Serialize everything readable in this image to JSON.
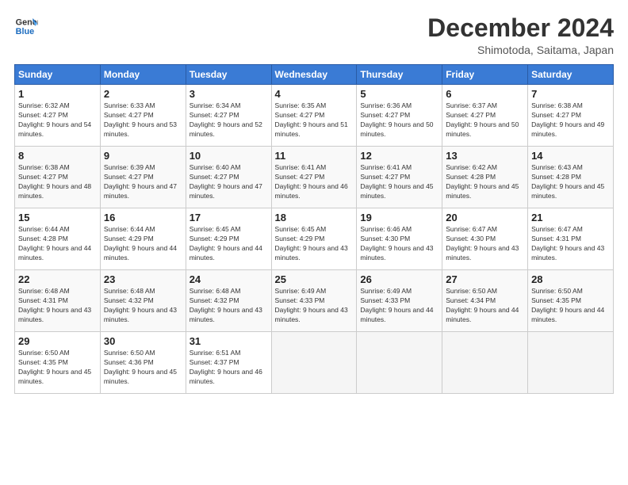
{
  "header": {
    "logo_line1": "General",
    "logo_line2": "Blue",
    "month": "December 2024",
    "location": "Shimotoda, Saitama, Japan"
  },
  "weekdays": [
    "Sunday",
    "Monday",
    "Tuesday",
    "Wednesday",
    "Thursday",
    "Friday",
    "Saturday"
  ],
  "weeks": [
    [
      {
        "num": "1",
        "sunrise": "6:32 AM",
        "sunset": "4:27 PM",
        "daylight": "9 hours and 54 minutes."
      },
      {
        "num": "2",
        "sunrise": "6:33 AM",
        "sunset": "4:27 PM",
        "daylight": "9 hours and 53 minutes."
      },
      {
        "num": "3",
        "sunrise": "6:34 AM",
        "sunset": "4:27 PM",
        "daylight": "9 hours and 52 minutes."
      },
      {
        "num": "4",
        "sunrise": "6:35 AM",
        "sunset": "4:27 PM",
        "daylight": "9 hours and 51 minutes."
      },
      {
        "num": "5",
        "sunrise": "6:36 AM",
        "sunset": "4:27 PM",
        "daylight": "9 hours and 50 minutes."
      },
      {
        "num": "6",
        "sunrise": "6:37 AM",
        "sunset": "4:27 PM",
        "daylight": "9 hours and 50 minutes."
      },
      {
        "num": "7",
        "sunrise": "6:38 AM",
        "sunset": "4:27 PM",
        "daylight": "9 hours and 49 minutes."
      }
    ],
    [
      {
        "num": "8",
        "sunrise": "6:38 AM",
        "sunset": "4:27 PM",
        "daylight": "9 hours and 48 minutes."
      },
      {
        "num": "9",
        "sunrise": "6:39 AM",
        "sunset": "4:27 PM",
        "daylight": "9 hours and 47 minutes."
      },
      {
        "num": "10",
        "sunrise": "6:40 AM",
        "sunset": "4:27 PM",
        "daylight": "9 hours and 47 minutes."
      },
      {
        "num": "11",
        "sunrise": "6:41 AM",
        "sunset": "4:27 PM",
        "daylight": "9 hours and 46 minutes."
      },
      {
        "num": "12",
        "sunrise": "6:41 AM",
        "sunset": "4:27 PM",
        "daylight": "9 hours and 45 minutes."
      },
      {
        "num": "13",
        "sunrise": "6:42 AM",
        "sunset": "4:28 PM",
        "daylight": "9 hours and 45 minutes."
      },
      {
        "num": "14",
        "sunrise": "6:43 AM",
        "sunset": "4:28 PM",
        "daylight": "9 hours and 45 minutes."
      }
    ],
    [
      {
        "num": "15",
        "sunrise": "6:44 AM",
        "sunset": "4:28 PM",
        "daylight": "9 hours and 44 minutes."
      },
      {
        "num": "16",
        "sunrise": "6:44 AM",
        "sunset": "4:29 PM",
        "daylight": "9 hours and 44 minutes."
      },
      {
        "num": "17",
        "sunrise": "6:45 AM",
        "sunset": "4:29 PM",
        "daylight": "9 hours and 44 minutes."
      },
      {
        "num": "18",
        "sunrise": "6:45 AM",
        "sunset": "4:29 PM",
        "daylight": "9 hours and 43 minutes."
      },
      {
        "num": "19",
        "sunrise": "6:46 AM",
        "sunset": "4:30 PM",
        "daylight": "9 hours and 43 minutes."
      },
      {
        "num": "20",
        "sunrise": "6:47 AM",
        "sunset": "4:30 PM",
        "daylight": "9 hours and 43 minutes."
      },
      {
        "num": "21",
        "sunrise": "6:47 AM",
        "sunset": "4:31 PM",
        "daylight": "9 hours and 43 minutes."
      }
    ],
    [
      {
        "num": "22",
        "sunrise": "6:48 AM",
        "sunset": "4:31 PM",
        "daylight": "9 hours and 43 minutes."
      },
      {
        "num": "23",
        "sunrise": "6:48 AM",
        "sunset": "4:32 PM",
        "daylight": "9 hours and 43 minutes."
      },
      {
        "num": "24",
        "sunrise": "6:48 AM",
        "sunset": "4:32 PM",
        "daylight": "9 hours and 43 minutes."
      },
      {
        "num": "25",
        "sunrise": "6:49 AM",
        "sunset": "4:33 PM",
        "daylight": "9 hours and 43 minutes."
      },
      {
        "num": "26",
        "sunrise": "6:49 AM",
        "sunset": "4:33 PM",
        "daylight": "9 hours and 44 minutes."
      },
      {
        "num": "27",
        "sunrise": "6:50 AM",
        "sunset": "4:34 PM",
        "daylight": "9 hours and 44 minutes."
      },
      {
        "num": "28",
        "sunrise": "6:50 AM",
        "sunset": "4:35 PM",
        "daylight": "9 hours and 44 minutes."
      }
    ],
    [
      {
        "num": "29",
        "sunrise": "6:50 AM",
        "sunset": "4:35 PM",
        "daylight": "9 hours and 45 minutes."
      },
      {
        "num": "30",
        "sunrise": "6:50 AM",
        "sunset": "4:36 PM",
        "daylight": "9 hours and 45 minutes."
      },
      {
        "num": "31",
        "sunrise": "6:51 AM",
        "sunset": "4:37 PM",
        "daylight": "9 hours and 46 minutes."
      },
      null,
      null,
      null,
      null
    ]
  ]
}
